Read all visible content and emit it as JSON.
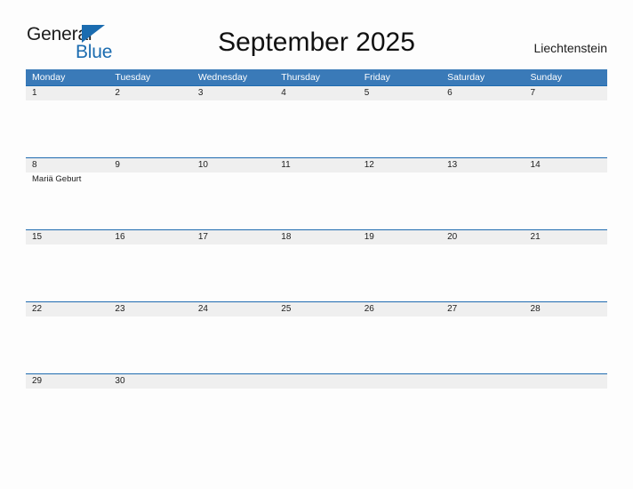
{
  "brand": {
    "line1": "General",
    "line2": "Blue",
    "triangle_color": "#1b6cb0"
  },
  "header": {
    "title": "September 2025",
    "region": "Liechtenstein"
  },
  "colors": {
    "weekday_header_bg": "#3a7ab8",
    "row_divider": "#1f6bb0",
    "day_band_bg": "#efefef",
    "page_bg": "#fdfdfd",
    "text": "#1d1d1d",
    "brand_blue": "#1b6cb0"
  },
  "calendar": {
    "weekdays": [
      "Monday",
      "Tuesday",
      "Wednesday",
      "Thursday",
      "Friday",
      "Saturday",
      "Sunday"
    ],
    "weeks": [
      {
        "days": [
          {
            "num": "1",
            "events": []
          },
          {
            "num": "2",
            "events": []
          },
          {
            "num": "3",
            "events": []
          },
          {
            "num": "4",
            "events": []
          },
          {
            "num": "5",
            "events": []
          },
          {
            "num": "6",
            "events": []
          },
          {
            "num": "7",
            "events": []
          }
        ]
      },
      {
        "days": [
          {
            "num": "8",
            "events": [
              "Mariä Geburt"
            ]
          },
          {
            "num": "9",
            "events": []
          },
          {
            "num": "10",
            "events": []
          },
          {
            "num": "11",
            "events": []
          },
          {
            "num": "12",
            "events": []
          },
          {
            "num": "13",
            "events": []
          },
          {
            "num": "14",
            "events": []
          }
        ]
      },
      {
        "days": [
          {
            "num": "15",
            "events": []
          },
          {
            "num": "16",
            "events": []
          },
          {
            "num": "17",
            "events": []
          },
          {
            "num": "18",
            "events": []
          },
          {
            "num": "19",
            "events": []
          },
          {
            "num": "20",
            "events": []
          },
          {
            "num": "21",
            "events": []
          }
        ]
      },
      {
        "days": [
          {
            "num": "22",
            "events": []
          },
          {
            "num": "23",
            "events": []
          },
          {
            "num": "24",
            "events": []
          },
          {
            "num": "25",
            "events": []
          },
          {
            "num": "26",
            "events": []
          },
          {
            "num": "27",
            "events": []
          },
          {
            "num": "28",
            "events": []
          }
        ]
      },
      {
        "days": [
          {
            "num": "29",
            "events": []
          },
          {
            "num": "30",
            "events": []
          },
          {
            "num": "",
            "events": []
          },
          {
            "num": "",
            "events": []
          },
          {
            "num": "",
            "events": []
          },
          {
            "num": "",
            "events": []
          },
          {
            "num": "",
            "events": []
          }
        ]
      }
    ]
  }
}
